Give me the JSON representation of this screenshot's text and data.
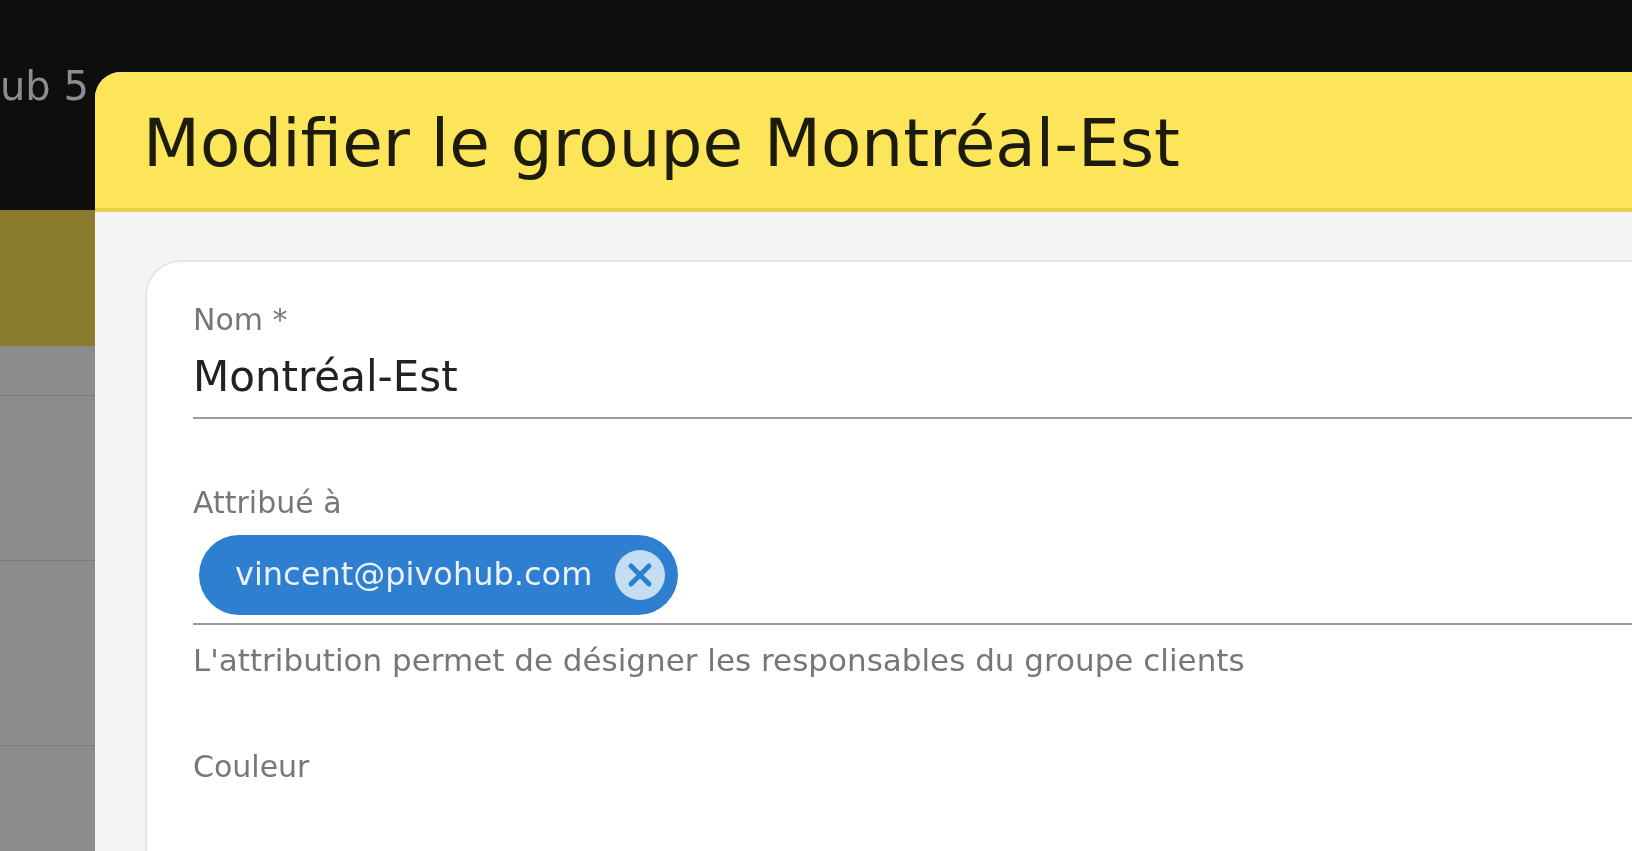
{
  "background": {
    "title_fragment": "ub 5"
  },
  "modal": {
    "title": "Modifier le groupe Montréal-Est",
    "fields": [
      {
        "kind": "text",
        "label": "Nom *",
        "value": "Montréal-Est"
      },
      {
        "kind": "chips",
        "label": "Attribué à",
        "chips": [
          {
            "text": "vincent@pivohub.com"
          }
        ],
        "hint": "L'attribution permet de désigner les responsables du groupe clients"
      },
      {
        "kind": "color",
        "label": "Couleur"
      }
    ]
  }
}
